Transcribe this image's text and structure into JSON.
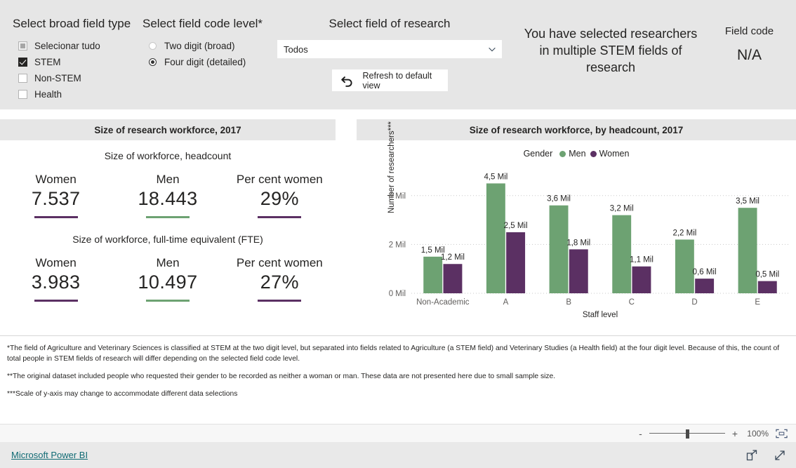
{
  "filters": {
    "broad_field": {
      "title": "Select broad field type",
      "options": [
        {
          "label": "Selecionar tudo",
          "state": "partial"
        },
        {
          "label": "STEM",
          "state": "checked"
        },
        {
          "label": "Non-STEM",
          "state": "unchecked"
        },
        {
          "label": "Health",
          "state": "unchecked"
        }
      ]
    },
    "code_level": {
      "title": "Select field code level*",
      "options": [
        {
          "label": "Two digit (broad)",
          "selected": false
        },
        {
          "label": "Four digit (detailed)",
          "selected": true
        }
      ]
    },
    "field_of_research": {
      "title": "Select field of research",
      "value": "Todos",
      "refresh_label": "Refresh to default view"
    },
    "selection_message": "You have selected researchers in multiple STEM fields of research",
    "field_code": {
      "label": "Field code",
      "value": "N/A"
    }
  },
  "left_panel": {
    "title": "Size of research workforce, 2017",
    "headcount": {
      "caption": "Size of workforce, headcount",
      "items": [
        {
          "name": "Women",
          "value": "7.537",
          "accent": "#5b3063"
        },
        {
          "name": "Men",
          "value": "18.443",
          "accent": "#6da272"
        },
        {
          "name": "Per cent women",
          "value": "29%",
          "accent": "#5b3063"
        }
      ]
    },
    "fte": {
      "caption": "Size of workforce, full-time equivalent (FTE)",
      "items": [
        {
          "name": "Women",
          "value": "3.983",
          "accent": "#5b3063"
        },
        {
          "name": "Men",
          "value": "10.497",
          "accent": "#6da272"
        },
        {
          "name": "Per cent women",
          "value": "27%",
          "accent": "#5b3063"
        }
      ]
    }
  },
  "right_panel": {
    "title": "Size of research workforce, by headcount, 2017",
    "legend_title": "Gender"
  },
  "chart_data": {
    "type": "bar",
    "title": "Size of research workforce, by headcount, 2017",
    "xlabel": "Staff level",
    "ylabel": "Number of researchers***",
    "categories": [
      "Non-Academic",
      "A",
      "B",
      "C",
      "D",
      "E"
    ],
    "series": [
      {
        "name": "Men",
        "color": "#6da272",
        "values": [
          1.5,
          4.5,
          3.6,
          3.2,
          2.2,
          3.5
        ],
        "labels": [
          "1,5 Mil",
          "4,5 Mil",
          "3,6 Mil",
          "3,2 Mil",
          "2,2 Mil",
          "3,5 Mil"
        ]
      },
      {
        "name": "Women",
        "color": "#5b3063",
        "values": [
          1.2,
          2.5,
          1.8,
          1.1,
          0.6,
          0.5
        ],
        "labels": [
          "1,2 Mil",
          "2,5 Mil",
          "1,8 Mil",
          "1,1 Mil",
          "0,6 Mil",
          "0,5 Mil"
        ]
      }
    ],
    "ylim": [
      0,
      5
    ],
    "yticks": [
      0,
      2,
      4
    ],
    "ytick_labels": [
      "0 Mil",
      "2 Mil",
      "4 Mil"
    ],
    "grid": true,
    "legend_position": "top"
  },
  "notes": [
    "*The field of Agriculture and Veterinary Sciences is classified at STEM at the two digit level, but separated into fields related to Agriculture (a STEM field) and Veterinary Studies (a Health field) at the four digit level. Because of this, the count of total people in STEM fields of research will differ depending on the selected field code level.",
    "**The original dataset included people who requested their gender to be recorded as neither a woman or man. These data are not presented here due to small sample size.",
    "***Scale of y-axis may change to accommodate different data selections"
  ],
  "statusbar": {
    "zoom_minus": "-",
    "zoom_plus": "+",
    "zoom_level": "100%"
  },
  "footer": {
    "brand": "Microsoft Power BI"
  }
}
